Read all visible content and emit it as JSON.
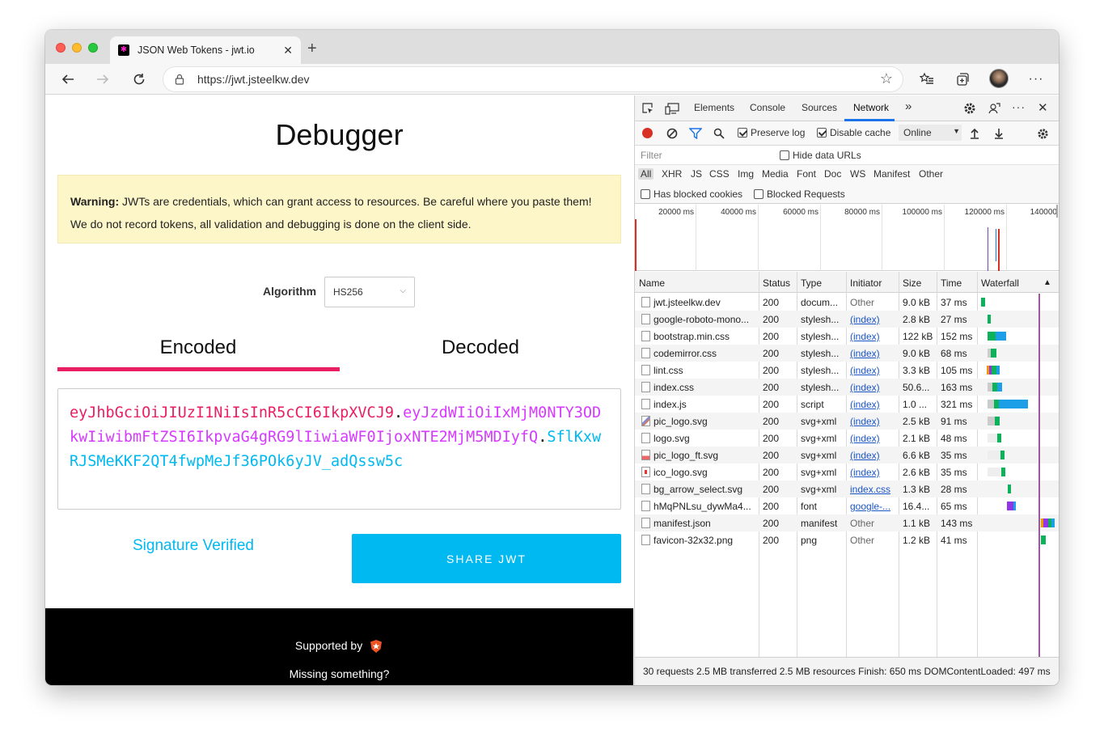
{
  "browser": {
    "tab_title": "JSON Web Tokens - jwt.io",
    "new_tab_label": "+",
    "url": "https://jwt.jsteelkw.dev"
  },
  "page": {
    "heading": "Debugger",
    "warning_bold": "Warning:",
    "warning_text": " JWTs are credentials, which can grant access to resources. Be careful where you paste them!",
    "warning_line2": "We do not record tokens, all validation and debugging is done on the client side.",
    "algorithm_label": "Algorithm",
    "algorithm_value": "HS256",
    "tab_encoded": "Encoded",
    "tab_decoded": "Decoded",
    "token_header": "eyJhbGciOiJIUzI1NiIsInR5cCI6IkpXVCJ9",
    "token_dot": ".",
    "token_payload": "eyJzdWIiOiIxMjM0NTY3ODkwIiwibmFtZSI6IkpvaG4gRG9lIiwiaWF0IjoxNTE2MjM5MDIyfQ",
    "token_signature": "SflKxwRJSMeKKF2QT4fwpMeJf36POk6yJV_adQssw5c",
    "signature_status": "Signature Verified",
    "share_button": "SHARE JWT",
    "footer_supported": "Supported by",
    "footer_missing": "Missing something?"
  },
  "devtools": {
    "tabs": [
      "Elements",
      "Console",
      "Sources",
      "Network"
    ],
    "active_tab": "Network",
    "more_tabs": "»",
    "preserve_log": "Preserve log",
    "disable_cache": "Disable cache",
    "throttle": "Online",
    "filter_placeholder": "Filter",
    "hide_data_urls": "Hide data URLs",
    "type_filters": [
      "All",
      "XHR",
      "JS",
      "CSS",
      "Img",
      "Media",
      "Font",
      "Doc",
      "WS",
      "Manifest",
      "Other"
    ],
    "has_blocked_cookies": "Has blocked cookies",
    "blocked_requests": "Blocked Requests",
    "timeline_labels": [
      "20000 ms",
      "40000 ms",
      "60000 ms",
      "80000 ms",
      "100000 ms",
      "120000 ms",
      "140000"
    ],
    "columns": [
      "Name",
      "Status",
      "Type",
      "Initiator",
      "Size",
      "Time",
      "Waterfall"
    ],
    "sort_indicator": "▲",
    "requests": [
      {
        "name": "jwt.jsteelkw.dev",
        "status": "200",
        "type": "docum...",
        "initiator": "Other",
        "size": "9.0 kB",
        "time": "37 ms"
      },
      {
        "name": "google-roboto-mono...",
        "status": "200",
        "type": "stylesh...",
        "initiator": "(index)",
        "size": "2.8 kB",
        "time": "27 ms"
      },
      {
        "name": "bootstrap.min.css",
        "status": "200",
        "type": "stylesh...",
        "initiator": "(index)",
        "size": "122 kB",
        "time": "152 ms"
      },
      {
        "name": "codemirror.css",
        "status": "200",
        "type": "stylesh...",
        "initiator": "(index)",
        "size": "9.0 kB",
        "time": "68 ms"
      },
      {
        "name": "lint.css",
        "status": "200",
        "type": "stylesh...",
        "initiator": "(index)",
        "size": "3.3 kB",
        "time": "105 ms"
      },
      {
        "name": "index.css",
        "status": "200",
        "type": "stylesh...",
        "initiator": "(index)",
        "size": "50.6...",
        "time": "163 ms"
      },
      {
        "name": "index.js",
        "status": "200",
        "type": "script",
        "initiator": "(index)",
        "size": "1.0 ...",
        "time": "321 ms"
      },
      {
        "name": "pic_logo.svg",
        "status": "200",
        "type": "svg+xml",
        "initiator": "(index)",
        "size": "2.5 kB",
        "time": "91 ms"
      },
      {
        "name": "logo.svg",
        "status": "200",
        "type": "svg+xml",
        "initiator": "(index)",
        "size": "2.1 kB",
        "time": "48 ms"
      },
      {
        "name": "pic_logo_ft.svg",
        "status": "200",
        "type": "svg+xml",
        "initiator": "(index)",
        "size": "6.6 kB",
        "time": "35 ms"
      },
      {
        "name": "ico_logo.svg",
        "status": "200",
        "type": "svg+xml",
        "initiator": "(index)",
        "size": "2.6 kB",
        "time": "35 ms"
      },
      {
        "name": "bg_arrow_select.svg",
        "status": "200",
        "type": "svg+xml",
        "initiator": "index.css",
        "size": "1.3 kB",
        "time": "28 ms"
      },
      {
        "name": "hMqPNLsu_dywMa4...",
        "status": "200",
        "type": "font",
        "initiator": "google-...",
        "size": "16.4...",
        "time": "65 ms"
      },
      {
        "name": "manifest.json",
        "status": "200",
        "type": "manifest",
        "initiator": "Other",
        "size": "1.1 kB",
        "time": "143 ms"
      },
      {
        "name": "favicon-32x32.png",
        "status": "200",
        "type": "png",
        "initiator": "Other",
        "size": "1.2 kB",
        "time": "41 ms"
      }
    ],
    "summary": "30 requests  2.5 MB transferred  2.5 MB resources  Finish: 650 ms  DOMContentLoaded: 497 ms"
  },
  "colors": {
    "jwt_header": "#e91e63",
    "jwt_payload": "#d63aff",
    "jwt_signature": "#00b9f1",
    "share_bg": "#00b9f1",
    "warning_bg": "#fdf6c9"
  }
}
